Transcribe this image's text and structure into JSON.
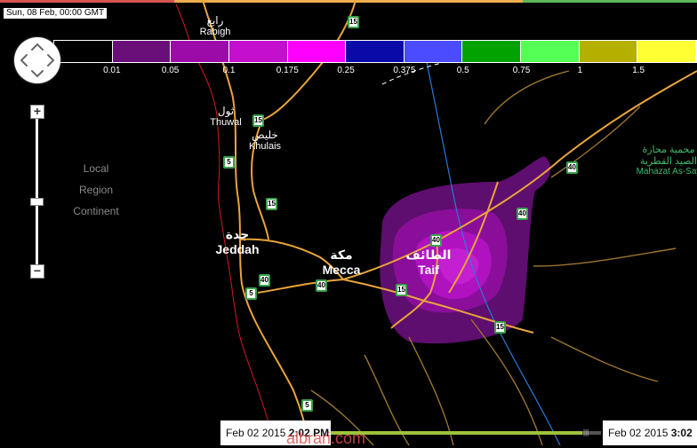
{
  "datestamp": "Sun, 08 Feb, 00:00 GMT",
  "top_bar_colors": [
    "#d9534f",
    "#f0ad4e",
    "#f0ad4e",
    "#5cb85c"
  ],
  "legend": {
    "colors": [
      "#000000",
      "#6a0f7a",
      "#9c0aa7",
      "#c40fce",
      "#ff00ff",
      "#0a0aa8",
      "#4b4bff",
      "#00a300",
      "#55ff55",
      "#b5b000",
      "#ffff33"
    ],
    "labels": [
      "0.01",
      "0.05",
      "0.1",
      "0.175",
      "0.25",
      "0.375",
      "0.5",
      "0.75",
      "1",
      "1.5"
    ]
  },
  "zoom_levels": [
    "Local",
    "Region",
    "Continent"
  ],
  "places": {
    "rabigh": {
      "ar": "رابغ",
      "en": "Rabigh"
    },
    "thuwal": {
      "ar": "ثول",
      "en": "Thuwal"
    },
    "khulais": {
      "ar": "خليص",
      "en": "Khulais"
    },
    "jeddah": {
      "ar": "جدة",
      "en": "Jeddah"
    },
    "mecca": {
      "ar": "مكة",
      "en": "Mecca"
    },
    "taif": {
      "ar": "الطائف",
      "en": "Taif"
    },
    "mahazat": {
      "ar1": "محمية محازة",
      "ar2": "الصيد القطرية",
      "en": "Mahazat As-Say"
    }
  },
  "road_shields": [
    "15",
    "15",
    "5",
    "15",
    "40",
    "5",
    "40",
    "40",
    "15",
    "40",
    "40",
    "15",
    "5"
  ],
  "timeline": {
    "start_date": "Feb 02 2015",
    "start_time": "2:02 PM",
    "end_date": "Feb 02 2015",
    "end_time": "3:02",
    "progress_percent": 93
  },
  "watermark": "albrari.com"
}
